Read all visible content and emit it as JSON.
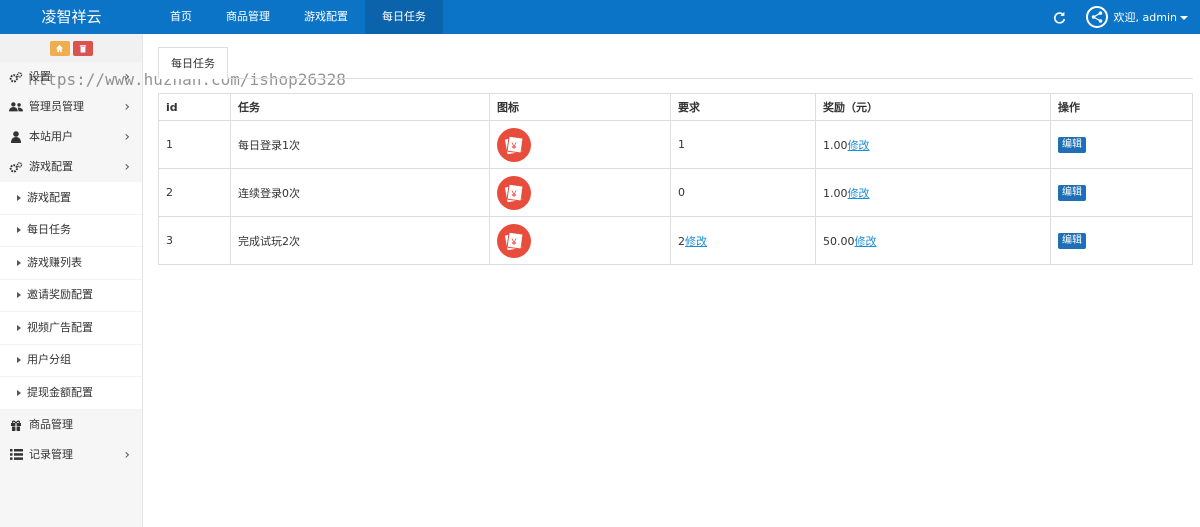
{
  "app": {
    "brand": "凌智祥云"
  },
  "nav": [
    {
      "label": "首页"
    },
    {
      "label": "商品管理"
    },
    {
      "label": "游戏配置"
    },
    {
      "label": "每日任务",
      "active": true
    }
  ],
  "user": {
    "welcome": "欢迎, admin"
  },
  "watermark": "https://www.huzhan.com/ishop26328",
  "sidebar": {
    "items": [
      {
        "label": "设置",
        "icon": "gears-icon"
      },
      {
        "label": "管理员管理",
        "icon": "users-icon"
      },
      {
        "label": "本站用户",
        "icon": "user-icon"
      },
      {
        "label": "游戏配置",
        "icon": "gears-icon"
      }
    ],
    "sub_items": [
      {
        "label": "游戏配置"
      },
      {
        "label": "每日任务"
      },
      {
        "label": "游戏赚列表"
      },
      {
        "label": "邀请奖励配置"
      },
      {
        "label": "视频广告配置"
      },
      {
        "label": "用户分组"
      },
      {
        "label": "提现金额配置"
      }
    ],
    "bottom_items": [
      {
        "label": "商品管理",
        "icon": "gift-icon"
      },
      {
        "label": "记录管理",
        "icon": "list-icon"
      }
    ]
  },
  "tab": {
    "label": "每日任务"
  },
  "table": {
    "headers": [
      "id",
      "任务",
      "图标",
      "要求",
      "奖励（元）",
      "操作"
    ],
    "rows": [
      {
        "id": "1",
        "task": "每日登录1次",
        "req": "1",
        "req_link": "",
        "reward": "1.00",
        "reward_link": "修改",
        "action": "编辑"
      },
      {
        "id": "2",
        "task": "连续登录0次",
        "req": "0",
        "req_link": "",
        "reward": "1.00",
        "reward_link": "修改",
        "action": "编辑"
      },
      {
        "id": "3",
        "task": "完成试玩2次",
        "req": "2",
        "req_link": "修改",
        "reward": "50.00",
        "reward_link": "修改",
        "action": "编辑"
      }
    ]
  },
  "colors": {
    "topbar": "#0b74c6",
    "nav_active": "#0a63ab",
    "icon_red": "#e74c3c",
    "link": "#1a8fd8",
    "button": "#1e6fb5"
  }
}
